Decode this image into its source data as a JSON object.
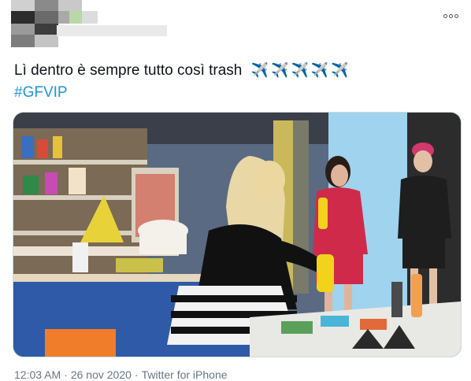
{
  "tweet": {
    "text": "Lì dentro è sempre tutto così trash",
    "emoji": "✈️✈️✈️✈️✈️",
    "hashtag": "#GFVIP"
  },
  "footer": {
    "time": "12:03 AM",
    "separator": "·",
    "date": "26 nov 2020",
    "source": "Twitter for iPhone"
  },
  "icons": {
    "more": "more-horizontal-icon",
    "emoji": "airplane-icon"
  },
  "colors": {
    "link": "#1b95e0",
    "meta": "#657786",
    "text": "#0f1419"
  }
}
